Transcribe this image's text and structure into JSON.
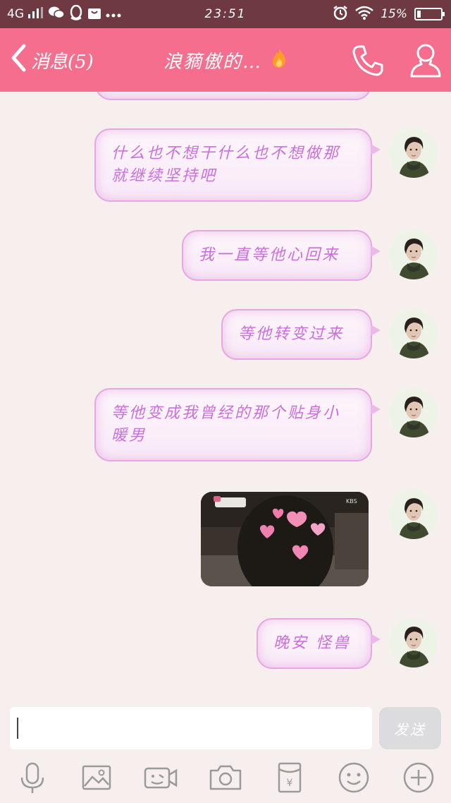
{
  "status_bar": {
    "network": "4G",
    "time": "23:51",
    "battery": "15%",
    "battery_level": 0.15
  },
  "header": {
    "back_label": "消息(5)",
    "title": "浪豴傲的…",
    "title_icon": "fire-icon"
  },
  "messages": [
    {
      "type": "text",
      "text": "什么也不想干什么也不想做那就继续坚持吧"
    },
    {
      "type": "text",
      "text": "我一直等他心回来"
    },
    {
      "type": "text",
      "text": "等他转变过来"
    },
    {
      "type": "text",
      "text": "等他变成我曾经的那个贴身小暖男"
    },
    {
      "type": "image",
      "watermark": "KBS"
    },
    {
      "type": "text",
      "text": "晚安 怪兽"
    }
  ],
  "input": {
    "value": "",
    "send_label": "发送"
  },
  "toolbar": [
    "mic-icon",
    "image-icon",
    "video-call-icon",
    "camera-icon",
    "red-packet-icon",
    "emoji-icon",
    "plus-icon"
  ],
  "colors": {
    "accent": "#f56e8e",
    "status_bar": "#6e3940",
    "bubble_text": "#cc6ee0",
    "bubble_border": "#e6a7e1",
    "background": "#f7efee"
  }
}
